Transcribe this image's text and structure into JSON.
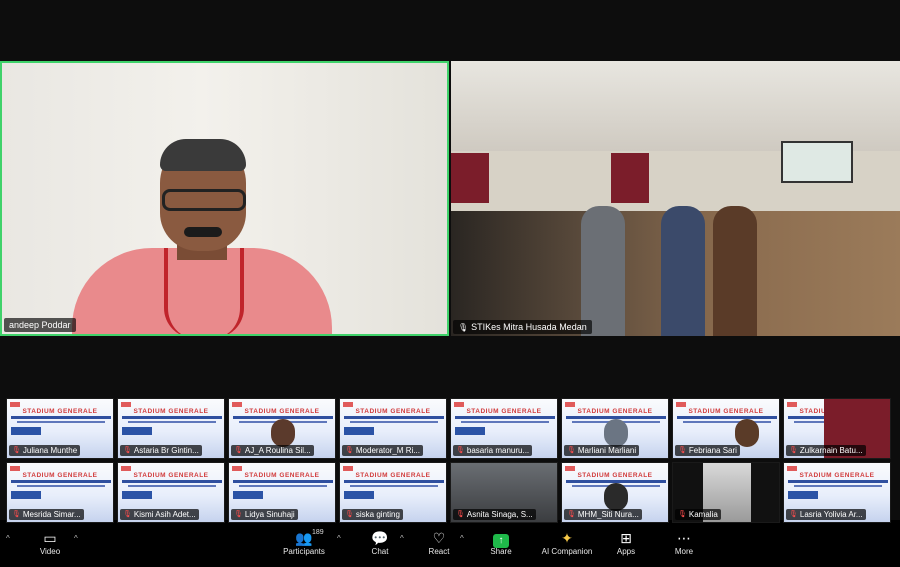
{
  "speakers": {
    "main": {
      "name": "andeep Poddar"
    },
    "room": {
      "name": "STIKes Mitra Husada Medan"
    }
  },
  "gallery": {
    "banner_title": "STADIUM GENERALE",
    "row1": [
      "Juliana Munthe",
      "Astaria Br Gintin...",
      "AJ_A Roulina Sil...",
      "Moderator_M Ri...",
      "basaria manuru...",
      "Marliani Marliani",
      "Febriana Sari",
      "Zulkarnain Batu..."
    ],
    "row2": [
      "Mesrida Simar...",
      "Kismi Asih Adet...",
      "Lidya Sinuhaji",
      "siska ginting",
      "Asnita Sinaga, S...",
      "MHM_Siti Nura...",
      "Kamalia",
      "Lasria Yolivia Ar..."
    ]
  },
  "toolbar": {
    "video": "Video",
    "participants": "Participants",
    "participants_count": "189",
    "chat": "Chat",
    "react": "React",
    "share": "Share",
    "ai_companion": "AI Companion",
    "apps": "Apps",
    "more": "More"
  },
  "colors": {
    "active_speaker_border": "#3fd26a",
    "share_button": "#1fb94a",
    "banner_red": "#d13b3b"
  }
}
